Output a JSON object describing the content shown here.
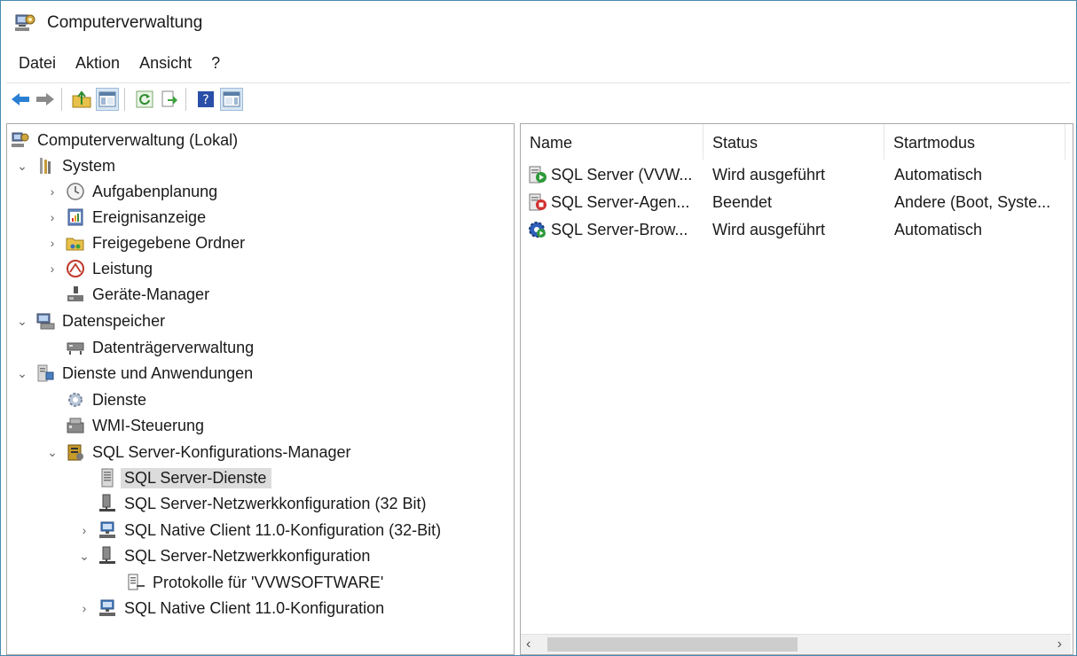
{
  "window": {
    "title": "Computerverwaltung"
  },
  "menu": [
    "Datei",
    "Aktion",
    "Ansicht",
    "?"
  ],
  "toolbar": {
    "buttons": [
      "back-icon",
      "forward-icon",
      "up-folder-icon",
      "show-tree-icon",
      "refresh-icon",
      "export-icon",
      "help-icon",
      "action-pane-icon"
    ]
  },
  "tree": [
    {
      "label": "Computerverwaltung (Lokal)",
      "icon": "computer-management-icon",
      "level": 0,
      "expander": ""
    },
    {
      "label": "System",
      "icon": "system-tools-icon",
      "level": 0,
      "expander": "expanded"
    },
    {
      "label": "Aufgabenplanung",
      "icon": "clock-icon",
      "level": 1,
      "expander": "collapsed"
    },
    {
      "label": "Ereignisanzeige",
      "icon": "event-viewer-icon",
      "level": 1,
      "expander": "collapsed"
    },
    {
      "label": "Freigegebene Ordner",
      "icon": "shared-folder-icon",
      "level": 1,
      "expander": "collapsed"
    },
    {
      "label": "Leistung",
      "icon": "performance-icon",
      "level": 1,
      "expander": "collapsed"
    },
    {
      "label": "Geräte-Manager",
      "icon": "device-manager-icon",
      "level": 1,
      "expander": ""
    },
    {
      "label": "Datenspeicher",
      "icon": "storage-icon",
      "level": 0,
      "expander": "expanded"
    },
    {
      "label": "Datenträgerverwaltung",
      "icon": "disk-icon",
      "level": 1,
      "expander": ""
    },
    {
      "label": "Dienste und Anwendungen",
      "icon": "services-apps-icon",
      "level": 0,
      "expander": "expanded"
    },
    {
      "label": "Dienste",
      "icon": "services-gear-icon",
      "level": 1,
      "expander": ""
    },
    {
      "label": "WMI-Steuerung",
      "icon": "wmi-icon",
      "level": 1,
      "expander": ""
    },
    {
      "label": "SQL Server-Konfigurations-Manager",
      "icon": "sql-config-manager-icon",
      "level": 1,
      "expander": "expanded"
    },
    {
      "label": "SQL Server-Dienste",
      "icon": "sql-services-icon",
      "level": 2,
      "expander": "",
      "selected": true
    },
    {
      "label": "SQL Server-Netzwerkkonfiguration (32 Bit)",
      "icon": "network-config-icon",
      "level": 2,
      "expander": ""
    },
    {
      "label": "SQL Native Client 11.0-Konfiguration (32-Bit)",
      "icon": "native-client-icon",
      "level": 2,
      "expander": "collapsed"
    },
    {
      "label": "SQL Server-Netzwerkkonfiguration",
      "icon": "network-config-icon",
      "level": 2,
      "expander": "expanded"
    },
    {
      "label": "Protokolle für 'VVWSOFTWARE'",
      "icon": "protocols-icon",
      "level": 3,
      "expander": ""
    },
    {
      "label": "SQL Native Client 11.0-Konfiguration",
      "icon": "native-client-icon",
      "level": 2,
      "expander": "collapsed"
    }
  ],
  "list": {
    "columns": [
      "Name",
      "Status",
      "Startmodus"
    ],
    "rows": [
      {
        "name": "SQL Server (VVW...",
        "status": "Wird ausgeführt",
        "start": "Automatisch",
        "icon": "service-running-icon"
      },
      {
        "name": "SQL Server-Agen...",
        "status": "Beendet",
        "start": "Andere (Boot, Syste...",
        "icon": "service-stopped-icon"
      },
      {
        "name": "SQL Server-Brow...",
        "status": "Wird ausgeführt",
        "start": "Automatisch",
        "icon": "service-browser-icon"
      }
    ],
    "scroll_left": "‹",
    "scroll_right": "›"
  }
}
